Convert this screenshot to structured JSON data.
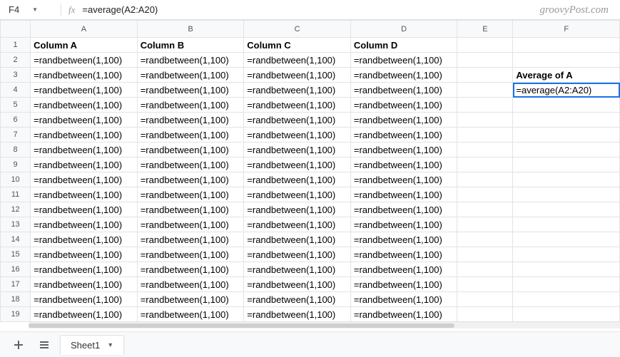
{
  "watermark": "groovyPost.com",
  "formula_bar": {
    "cell_ref": "F4",
    "fx_label": "fx",
    "formula": "=average(A2:A20)"
  },
  "columns": [
    "A",
    "B",
    "C",
    "D",
    "E",
    "F"
  ],
  "selected": {
    "col": "F",
    "row": 4
  },
  "headers_row": {
    "A": "Column A",
    "B": "Column B",
    "C": "Column C",
    "D": "Column D"
  },
  "rand_formula": "=randbetween(1,100)",
  "f3_label": "Average of A",
  "f4_value": "=average(A2:A20)",
  "data_row_start": 2,
  "data_row_end": 19,
  "sheet_tab": {
    "name": "Sheet1"
  }
}
